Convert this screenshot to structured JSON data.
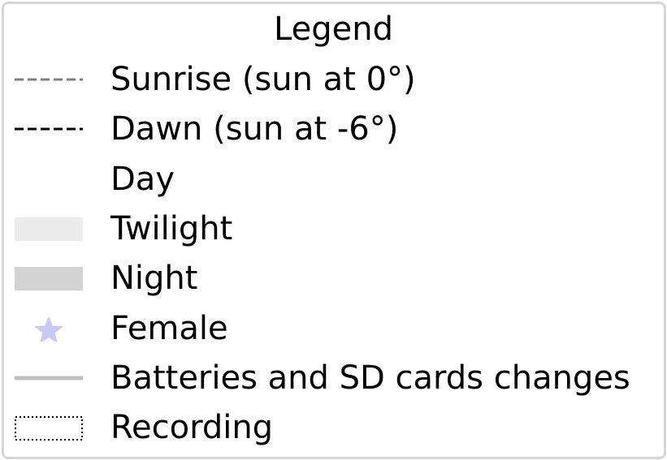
{
  "chart_data": {
    "type": "legend",
    "title": "Legend",
    "entries": [
      {
        "label": "Sunrise (sun at 0°)",
        "marker": "dashed-line",
        "color": "#808080"
      },
      {
        "label": "Dawn (sun at -6°)",
        "marker": "dashed-line",
        "color": "#000000"
      },
      {
        "label": "Day",
        "marker": "patch",
        "color": "#ffffff"
      },
      {
        "label": "Twilight",
        "marker": "patch",
        "color": "#ececec"
      },
      {
        "label": "Night",
        "marker": "patch",
        "color": "#d3d3d3"
      },
      {
        "label": "Female",
        "marker": "star",
        "color": "#c9c9f7"
      },
      {
        "label": "Batteries and SD cards changes",
        "marker": "solid-line",
        "color": "#c0c0c0"
      },
      {
        "label": "Recording",
        "marker": "dotted-box",
        "color": "#000000"
      }
    ]
  }
}
